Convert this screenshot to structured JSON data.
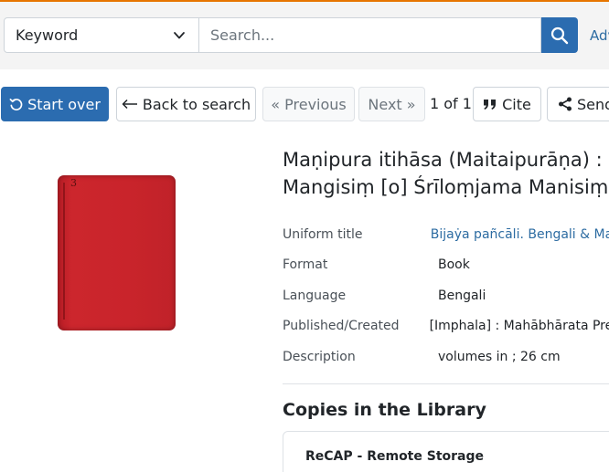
{
  "search": {
    "field_selected": "Keyword",
    "placeholder": "Search...",
    "advanced_label": "Adv"
  },
  "toolbar": {
    "start_over": "Start over",
    "back_to_search": "Back to search",
    "previous": "« Previous",
    "next": "Next »",
    "page_count": "1 of 1",
    "cite": "Cite",
    "send": "Send"
  },
  "record": {
    "title_line1": "Maṇipura itihāsa (Maitaipurāṇa) :",
    "title_line2": "Mangisiṃ [o] Śrīloṃjama Manisiṃ",
    "fields": [
      {
        "label": "Uniform title",
        "value": "Bijaẏa pañcāli. Bengali & Mar",
        "link": true
      },
      {
        "label": "Format",
        "value": "Book",
        "link": false
      },
      {
        "label": "Language",
        "value": "Bengali",
        "link": false
      },
      {
        "label": "Published/Created",
        "value": "[Imphala] : Mahābhārata Pres",
        "link": false
      },
      {
        "label": "Description",
        "value": "volumes in ; 26 cm",
        "link": false
      }
    ]
  },
  "copies": {
    "heading": "Copies in the Library",
    "location": "ReCAP - Remote Storage"
  },
  "colors": {
    "accent": "#e77500",
    "primary": "#2b6cb0",
    "link": "#2d6ca2",
    "cover": "#c9242b"
  },
  "icons": [
    "chevron-down-icon",
    "search-icon",
    "undo-icon",
    "arrow-left-icon",
    "quote-icon",
    "share-icon"
  ]
}
